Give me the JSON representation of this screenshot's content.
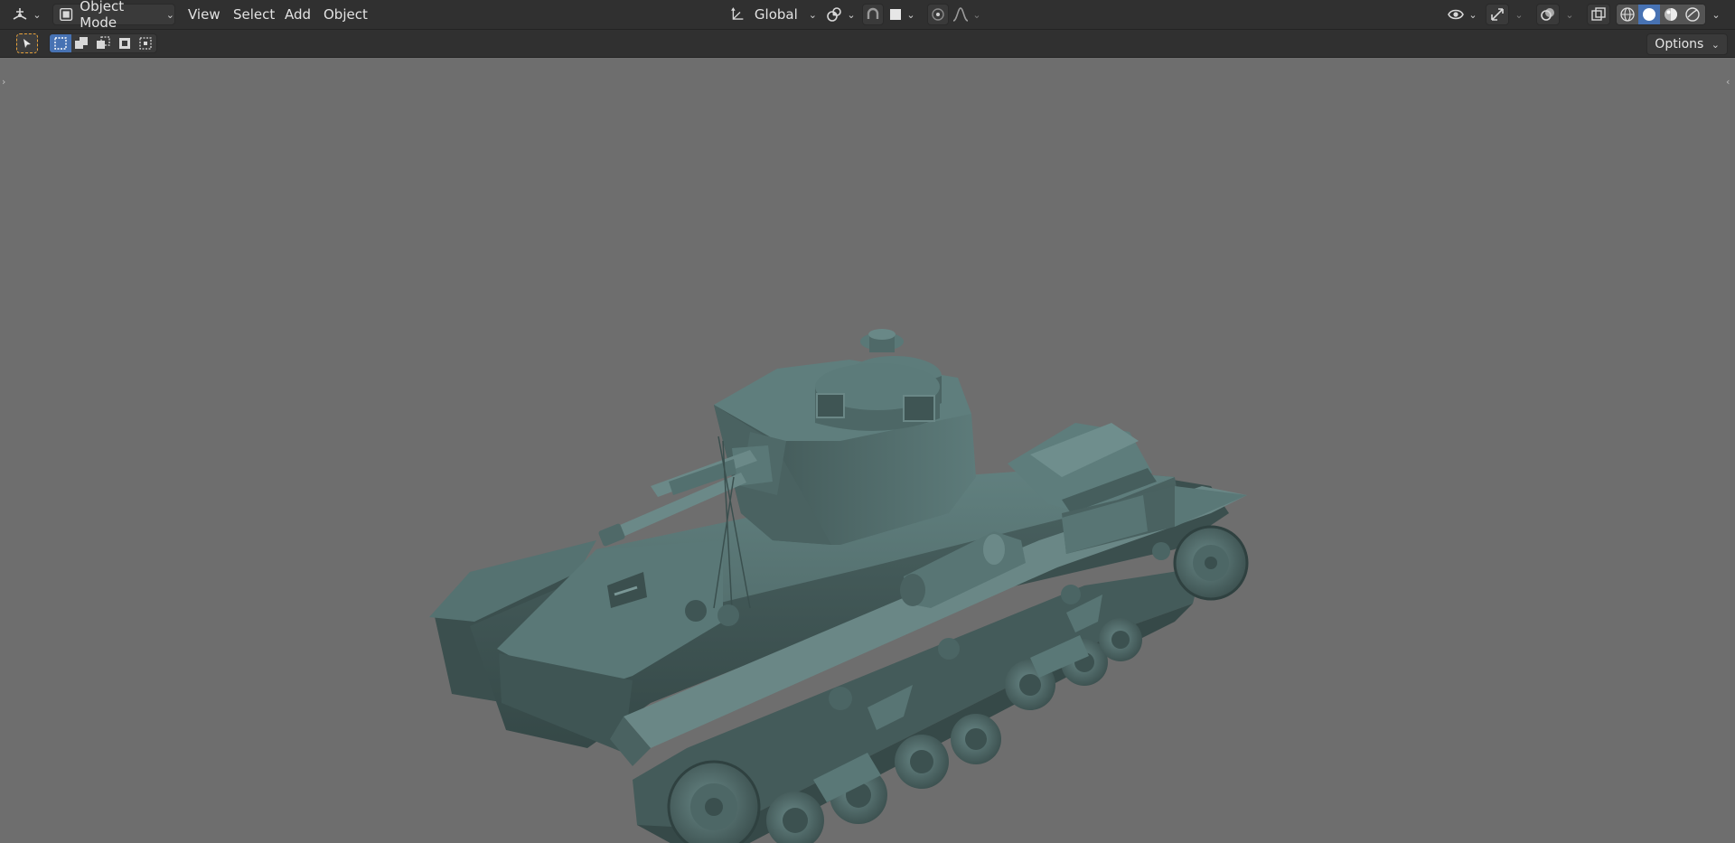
{
  "header": {
    "mode_label": "Object Mode",
    "menus": [
      "View",
      "Select",
      "Add",
      "Object"
    ],
    "transform_orientation": "Global"
  },
  "toolbar": {
    "options_label": "Options"
  },
  "icons": {
    "editor_type": "3d-viewport-icon",
    "mode": "object-mode-icon",
    "orientation": "transform-orientation-icon",
    "pivot": "pivot-point-icon",
    "snap": "snap-icon",
    "snap_target": "snap-increment-icon",
    "proportional": "proportional-editing-icon",
    "falloff": "falloff-curve-icon",
    "visibility": "eye-visibility-icon",
    "gizmo": "gizmo-icon",
    "overlays": "overlays-icon",
    "xray": "xray-icon",
    "shading_wireframe": "wireframe-shading-icon",
    "shading_solid": "solid-shading-icon",
    "shading_material": "material-preview-icon",
    "shading_rendered": "rendered-shading-icon",
    "select_tool": "select-box-tool-icon",
    "select_new": "select-new-icon",
    "select_extend": "select-extend-icon",
    "select_subtract": "select-subtract-icon",
    "select_invert": "select-invert-icon",
    "select_intersect": "select-intersect-icon"
  },
  "colors": {
    "header_bg": "#303030",
    "viewport_bg": "#6e6e6e",
    "accent": "#4772b3",
    "tool_active": "#e8a23a",
    "model": "#4f6766"
  },
  "viewport": {
    "active_shading": "solid",
    "scene_object": "tank-model"
  }
}
